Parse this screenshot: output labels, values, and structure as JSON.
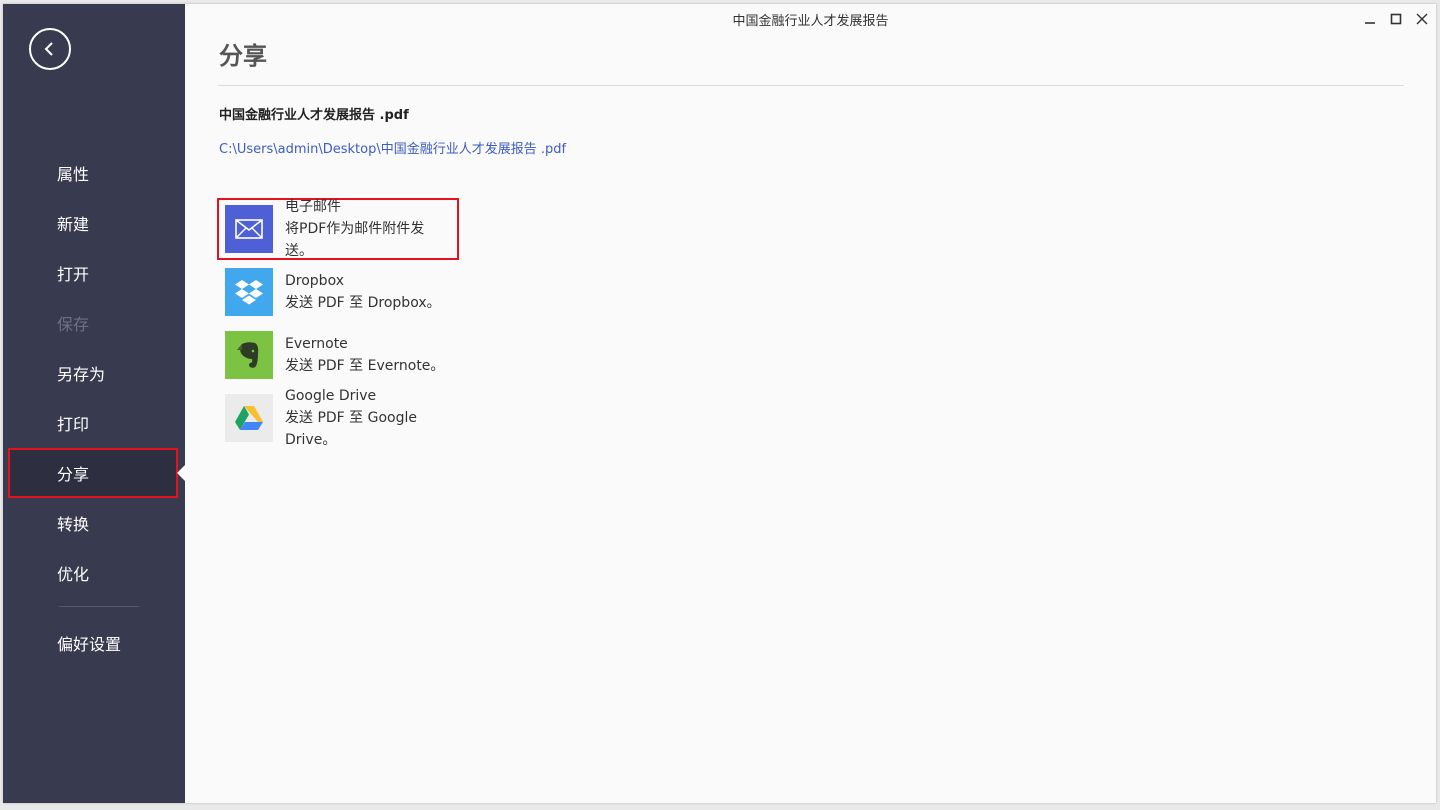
{
  "window": {
    "title": "中国金融行业人才发展报告"
  },
  "sidebar": {
    "items": [
      {
        "label": "属性"
      },
      {
        "label": "新建"
      },
      {
        "label": "打开"
      },
      {
        "label": "保存"
      },
      {
        "label": "另存为"
      },
      {
        "label": "打印"
      },
      {
        "label": "分享"
      },
      {
        "label": "转换"
      },
      {
        "label": "优化"
      },
      {
        "label": "偏好设置"
      }
    ],
    "active": "分享",
    "disabled": "保存"
  },
  "main": {
    "title": "分享",
    "file_name": "中国金融行业人才发展报告 .pdf",
    "file_path": "C:\\Users\\admin\\Desktop\\中国金融行业人才发展报告 .pdf",
    "options": [
      {
        "title": "电子邮件",
        "desc": "将PDF作为邮件附件发送。",
        "icon": "email-icon",
        "color": "#4f5fd6"
      },
      {
        "title": "Dropbox",
        "desc": "发送 PDF 至 Dropbox。",
        "icon": "dropbox-icon",
        "color": "#42a8ee"
      },
      {
        "title": "Evernote",
        "desc": "发送 PDF 至 Evernote。",
        "icon": "evernote-icon",
        "color": "#7cc243"
      },
      {
        "title": "Google Drive",
        "desc": "发送 PDF 至 Google Drive。",
        "icon": "google-drive-icon",
        "color": "#ebebeb"
      }
    ]
  },
  "colors": {
    "sidebar_bg": "#383a4f",
    "highlight": "#e3121c",
    "link": "#3e5cc2"
  }
}
